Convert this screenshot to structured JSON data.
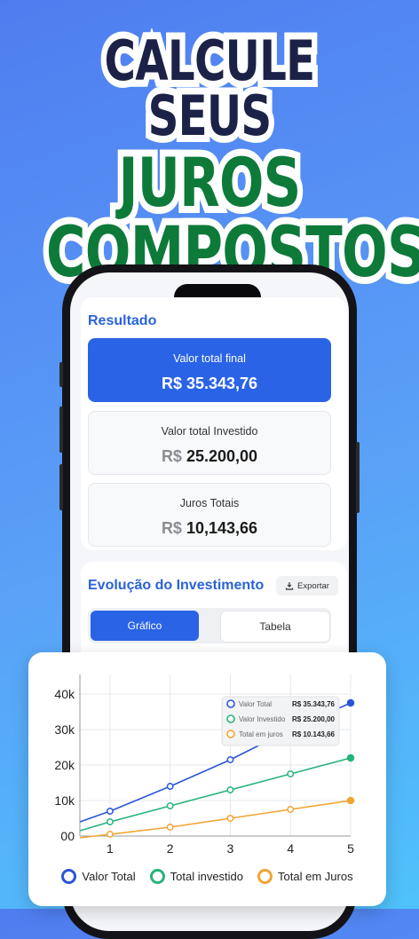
{
  "headline": {
    "line1": "CALCULE SEUS",
    "line2": "JUROS",
    "line3": "COMPOSTOS"
  },
  "result": {
    "title": "Resultado",
    "final": {
      "label": "Valor total final",
      "value": "R$ 35.343,76"
    },
    "invested": {
      "label": "Valor total Investido",
      "currency": "R$",
      "amount": "25.200,00"
    },
    "interest": {
      "label": "Juros Totais",
      "currency": "R$",
      "amount": "10,143,66"
    }
  },
  "evolution": {
    "title": "Evolução do Investimento",
    "export_label": "Exportar",
    "tab_chart": "Gráfico",
    "tab_table": "Tabela"
  },
  "chart_data": {
    "type": "line",
    "x": [
      0.5,
      1,
      2,
      3,
      4,
      5
    ],
    "xticks": [
      "1",
      "2",
      "3",
      "4",
      "5"
    ],
    "yticks": [
      "00",
      "10k",
      "20k",
      "30k",
      "40k"
    ],
    "ylim": [
      0,
      40000
    ],
    "grid": true,
    "legend": "bottom",
    "series": [
      {
        "name": "Valor Total",
        "color": "#2a55d6",
        "values": [
          4000,
          7000,
          14000,
          21500,
          30000,
          37500
        ]
      },
      {
        "name": "Total investido",
        "color": "#26b37a",
        "values": [
          1500,
          4000,
          8500,
          13000,
          17500,
          22000
        ]
      },
      {
        "name": "Total em Juros",
        "color": "#f2a533",
        "values": [
          -500,
          500,
          2500,
          5000,
          7500,
          10000
        ]
      }
    ],
    "tooltip": [
      {
        "label": "Valor Total",
        "value": "R$ 35.343,76",
        "color": "#2a55d6"
      },
      {
        "label": "Valor Investido",
        "value": "R$ 25.200,00",
        "color": "#26b37a"
      },
      {
        "label": "Total em juros",
        "value": "R$ 10.143,66",
        "color": "#f2a533"
      }
    ]
  }
}
